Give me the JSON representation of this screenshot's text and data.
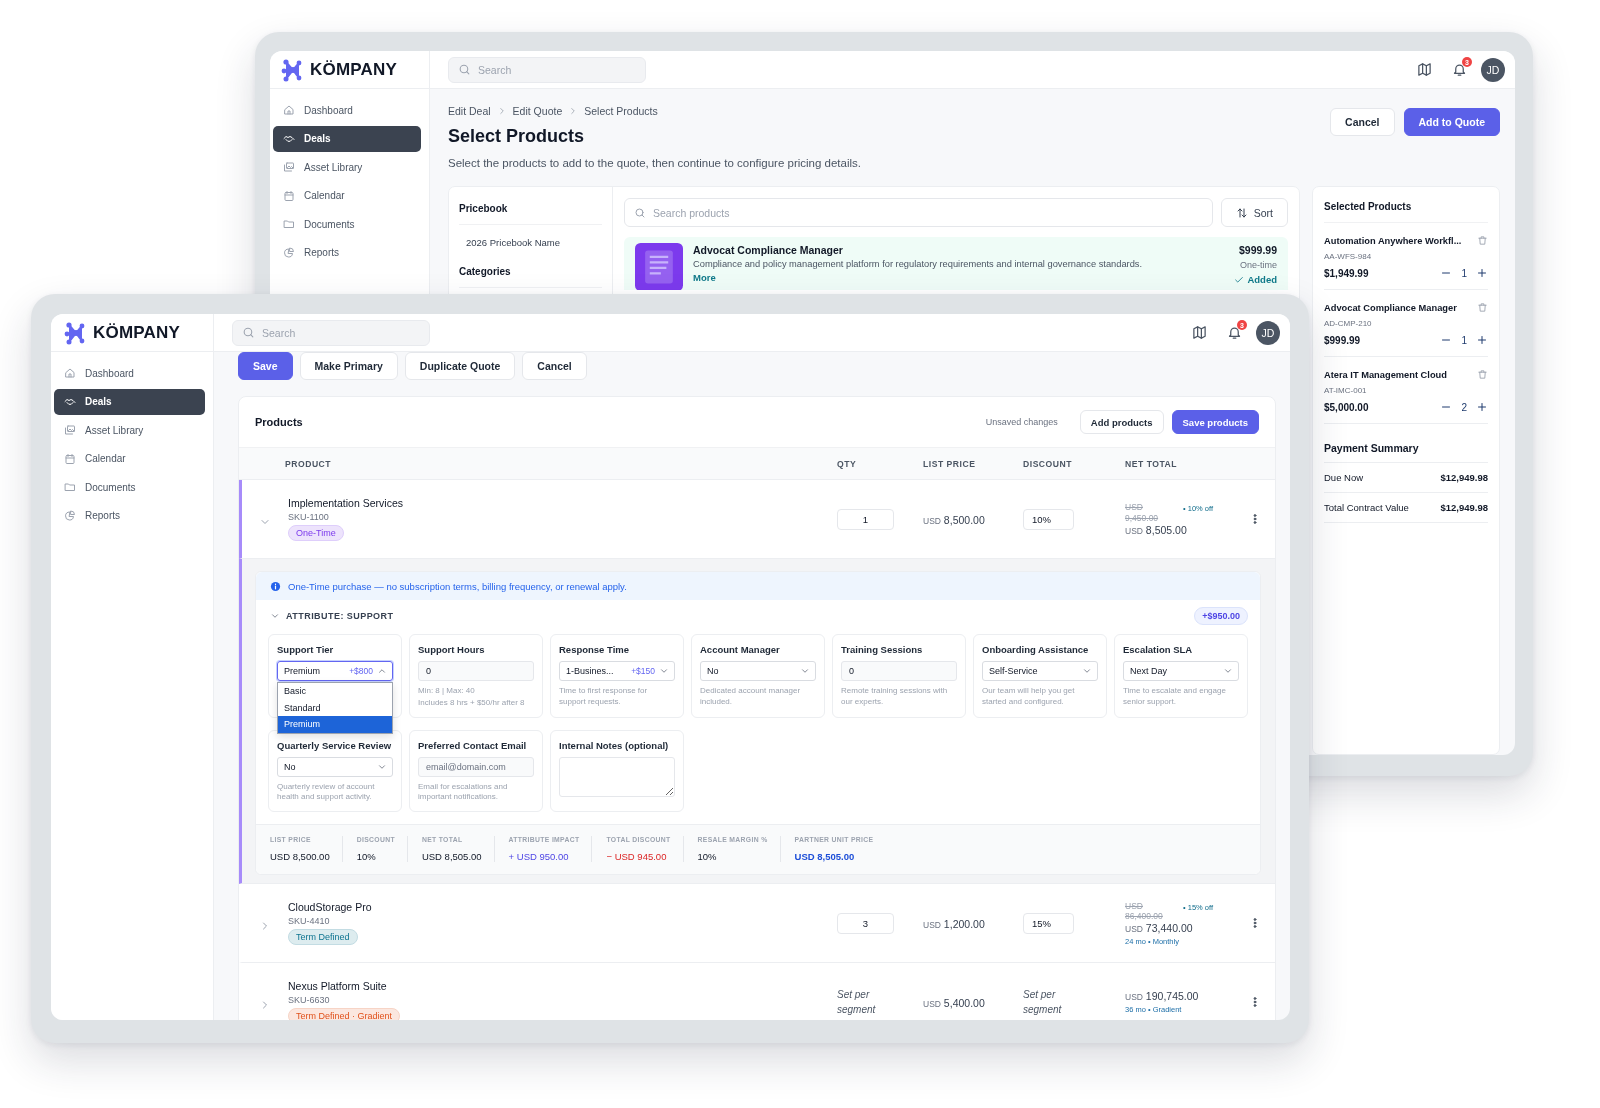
{
  "back_window": {
    "logo": "KÖMPANY",
    "search": {
      "placeholder": "Search"
    },
    "notifications": "3",
    "avatar": "JD",
    "sidebar": {
      "items": [
        {
          "label": "Dashboard",
          "selected": false
        },
        {
          "label": "Deals",
          "selected": true
        },
        {
          "label": "Asset Library",
          "selected": false
        },
        {
          "label": "Calendar",
          "selected": false
        },
        {
          "label": "Documents",
          "selected": false
        },
        {
          "label": "Reports",
          "selected": false
        }
      ]
    },
    "breadcrumbs": [
      "Edit Deal",
      "Edit Quote",
      "Select Products"
    ],
    "title": "Select Products",
    "subtitle": "Select the products to add to the quote, then continue to configure pricing details.",
    "buttons": [
      {
        "label": "Cancel",
        "kind": "secondary"
      },
      {
        "label": "Add to Quote",
        "kind": "primary"
      }
    ],
    "pricebook": {
      "heading": "Pricebook",
      "name": "2026 Pricebook Name",
      "categories_heading": "Categories"
    },
    "product_search": {
      "placeholder": "Search products"
    },
    "sort_button": "Sort",
    "products": [
      {
        "name": "Advocat Compliance Manager",
        "description": "Compliance and policy management platform for regulatory requirements and internal governance standards.",
        "more": "More",
        "price": "$999.99",
        "billing": "One-time",
        "status": "Added"
      }
    ],
    "selected_products": {
      "title": "Selected Products",
      "items": [
        {
          "name": "Automation Anywhere Workfl...",
          "sku": "AA-WFS-984",
          "price": "$1,949.99",
          "qty": "1"
        },
        {
          "name": "Advocat Compliance Manager",
          "sku": "AD-CMP-210",
          "price": "$999.99",
          "qty": "1"
        },
        {
          "name": "Atera IT Management Cloud",
          "sku": "AT-IMC-001",
          "price": "$5,000.00",
          "qty": "2"
        }
      ]
    },
    "payment_summary": {
      "title": "Payment Summary",
      "rows": [
        {
          "label": "Due Now",
          "value": "$12,949.98"
        },
        {
          "label": "Total Contract Value",
          "value": "$12,949.98"
        }
      ]
    }
  },
  "front_window": {
    "logo": "KÖMPANY",
    "search": {
      "placeholder": "Search"
    },
    "notifications": "3",
    "avatar": "JD",
    "sidebar": {
      "items": [
        {
          "label": "Dashboard",
          "selected": false
        },
        {
          "label": "Deals",
          "selected": true
        },
        {
          "label": "Asset Library",
          "selected": false
        },
        {
          "label": "Calendar",
          "selected": false
        },
        {
          "label": "Documents",
          "selected": false
        },
        {
          "label": "Reports",
          "selected": false
        }
      ]
    },
    "actions": [
      {
        "label": "Save",
        "kind": "primary"
      },
      {
        "label": "Make Primary",
        "kind": "secondary"
      },
      {
        "label": "Duplicate Quote",
        "kind": "secondary"
      },
      {
        "label": "Cancel",
        "kind": "secondary"
      }
    ],
    "products_card": {
      "title": "Products",
      "status": "Unsaved changes",
      "buttons": [
        {
          "label": "Add products",
          "kind": "secondary"
        },
        {
          "label": "Save products",
          "kind": "primary"
        }
      ],
      "columns": [
        "PRODUCT",
        "QTY",
        "LIST PRICE",
        "DISCOUNT",
        "NET TOTAL"
      ],
      "rows": [
        {
          "kind": "fixed",
          "expanded": true,
          "name": "Implementation Services",
          "sku": "SKU-1100",
          "tag": {
            "label": "One-Time",
            "kind": "one_time"
          },
          "qty": "1",
          "list_currency": "USD",
          "list_price": "8,500.00",
          "discount": "10%",
          "original_total": "USD 9,450.00",
          "off": "• 10% off",
          "net_currency": "USD",
          "net_total": "8,505.00",
          "details": {
            "notice": "One-Time purchase — no subscription terms, billing frequency, or renewal apply.",
            "attribute": {
              "title": "ATTRIBUTE: SUPPORT",
              "expanded": true,
              "impact": "+$950.00",
              "fields": [
                {
                  "kind": "select",
                  "label": "Support Tier",
                  "value": "Premium",
                  "price": "+$800",
                  "open": true,
                  "options": [
                    {
                      "label": "Basic",
                      "selected": false
                    },
                    {
                      "label": "Standard",
                      "selected": false
                    },
                    {
                      "label": "Premium",
                      "selected": true
                    }
                  ]
                },
                {
                  "kind": "input",
                  "label": "Support Hours",
                  "value": "0",
                  "help": "Min: 8 | Max: 40",
                  "note": "Includes 8 hrs + $50/hr after 8"
                },
                {
                  "kind": "select",
                  "label": "Response Time",
                  "value": "1-Busines...",
                  "price": "+$150",
                  "open": false,
                  "help": "Time to first response for support requests."
                },
                {
                  "kind": "select",
                  "label": "Account Manager",
                  "value": "No",
                  "open": false,
                  "help": "Dedicated account manager included."
                },
                {
                  "kind": "input",
                  "label": "Training Sessions",
                  "value": "0",
                  "help": "Remote training sessions with our experts."
                },
                {
                  "kind": "select",
                  "label": "Onboarding Assistance",
                  "value": "Self-Service",
                  "open": false,
                  "help": "Our team will help you get started and configured."
                },
                {
                  "kind": "select",
                  "label": "Escalation SLA",
                  "value": "Next Day",
                  "open": false,
                  "help": "Time to escalate and engage senior support."
                },
                {
                  "kind": "select",
                  "label": "Quarterly Service Review",
                  "value": "No",
                  "open": false,
                  "help": "Quarterly review of account health and support activity."
                },
                {
                  "kind": "input",
                  "label": "Preferred Contact Email",
                  "placeholder": "email@domain.com",
                  "help": "Email for escalations and important notifications."
                },
                {
                  "kind": "textarea",
                  "label": "Internal Notes (optional)"
                }
              ]
            },
            "summary": [
              {
                "label": "LIST PRICE",
                "value": "USD 8,500.00",
                "kind": "plain"
              },
              {
                "label": "DISCOUNT",
                "value": "10%",
                "kind": "plain"
              },
              {
                "label": "NET TOTAL",
                "value": "USD 8,505.00",
                "kind": "plain"
              },
              {
                "label": "ATTRIBUTE IMPACT",
                "value": "+ USD 950.00",
                "kind": "increase"
              },
              {
                "label": "TOTAL DISCOUNT",
                "value": "− USD 945.00",
                "kind": "decrease"
              },
              {
                "label": "RESALE MARGIN %",
                "value": "10%",
                "kind": "plain"
              },
              {
                "label": "PARTNER UNIT PRICE",
                "value": "USD 8,505.00",
                "kind": "highlight"
              }
            ]
          }
        },
        {
          "kind": "fixed",
          "expanded": false,
          "name": "CloudStorage Pro",
          "sku": "SKU-4410",
          "tag": {
            "label": "Term Defined",
            "kind": "term"
          },
          "qty": "3",
          "list_currency": "USD",
          "list_price": "1,200.00",
          "discount": "15%",
          "original_total": "USD 86,400.00",
          "off": "• 15% off",
          "net_currency": "USD",
          "net_total": "73,440.00",
          "term": "24 mo • Monthly"
        },
        {
          "kind": "segmented",
          "expanded": false,
          "name": "Nexus Platform Suite",
          "sku": "SKU-6630",
          "tag": {
            "label": "Term Defined · Gradient",
            "kind": "gradient"
          },
          "qty": "Set per segment",
          "list_currency": "USD",
          "list_price": "5,400.00",
          "discount": "Set per segment",
          "net_currency": "USD",
          "net_total": "190,745.00",
          "term": "36 mo • Gradient"
        }
      ]
    }
  }
}
